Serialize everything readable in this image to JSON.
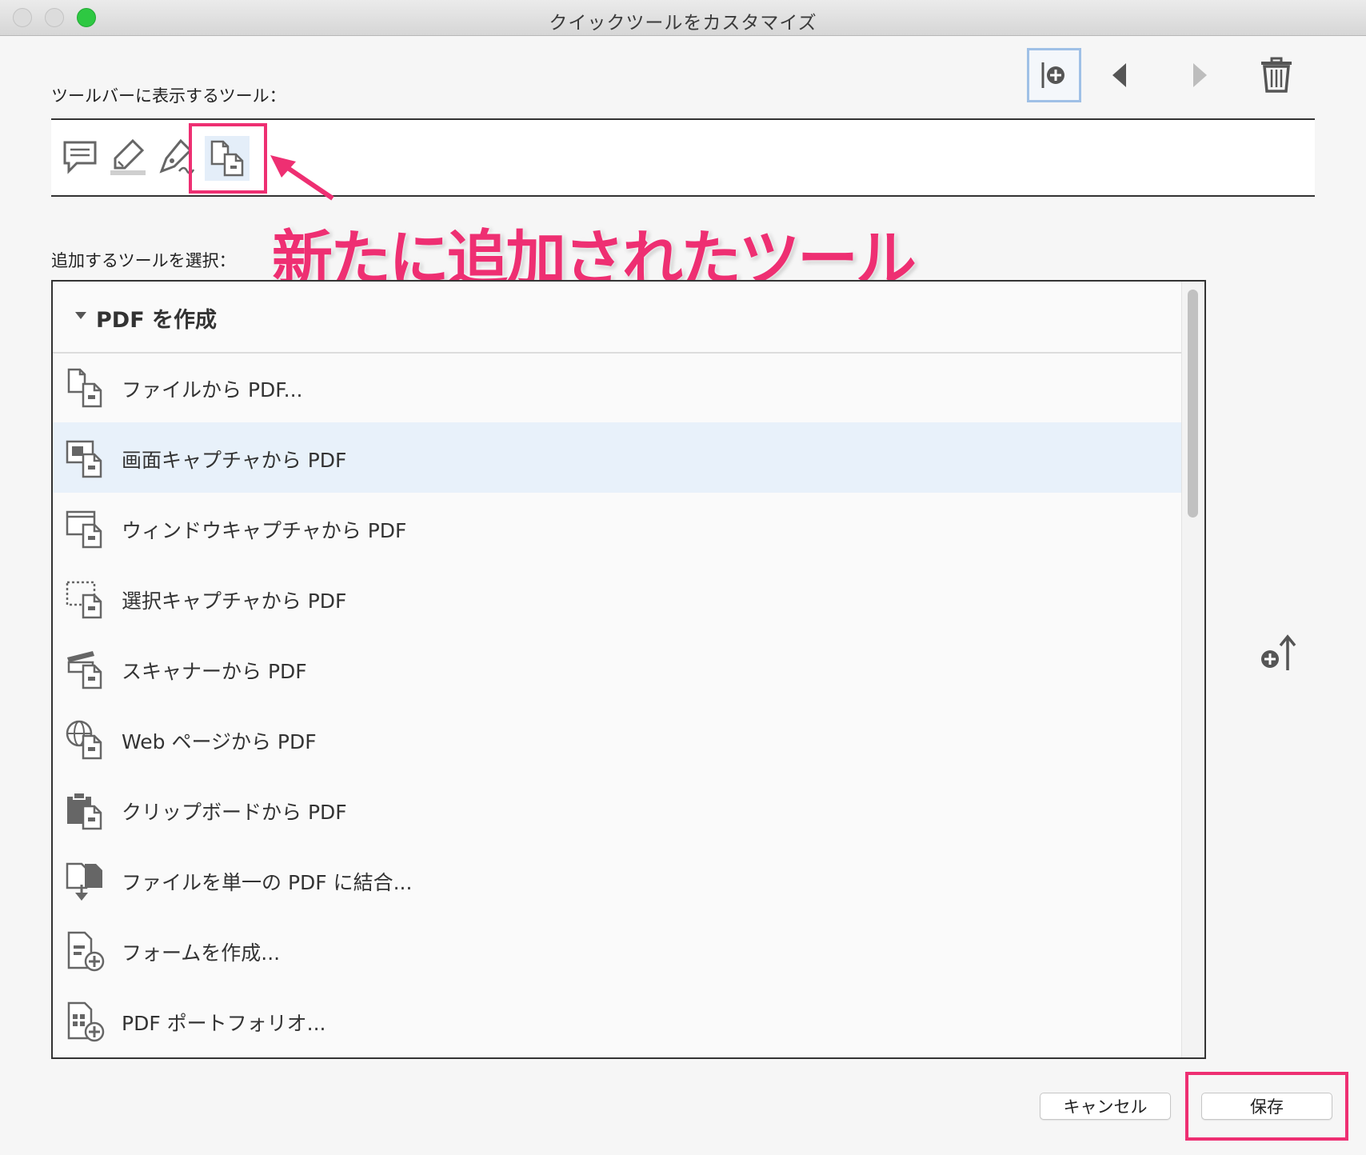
{
  "window": {
    "title": "クイックツールをカスタマイズ"
  },
  "toolbar_section": {
    "label": "ツールバーに表示するツール："
  },
  "annotation": {
    "text": "新たに追加されたツール",
    "color": "#ee2f72"
  },
  "select_section": {
    "label": "追加するツールを選択："
  },
  "group": {
    "title": "PDF を作成"
  },
  "items": [
    {
      "label": "ファイルから PDF...",
      "icon": "file-to-pdf-icon"
    },
    {
      "label": "画面キャプチャから PDF",
      "icon": "screen-capture-icon"
    },
    {
      "label": "ウィンドウキャプチャから PDF",
      "icon": "window-capture-icon"
    },
    {
      "label": "選択キャプチャから PDF",
      "icon": "selection-capture-icon"
    },
    {
      "label": "スキャナーから PDF",
      "icon": "scanner-icon"
    },
    {
      "label": "Web ページから PDF",
      "icon": "globe-icon"
    },
    {
      "label": "クリップボードから PDF",
      "icon": "clipboard-icon"
    },
    {
      "label": "ファイルを単一の PDF に結合...",
      "icon": "combine-files-icon"
    },
    {
      "label": "フォームを作成...",
      "icon": "create-form-icon"
    },
    {
      "label": "PDF ポートフォリオ...",
      "icon": "portfolio-icon"
    }
  ],
  "selected_item_index": 1,
  "buttons": {
    "cancel": "キャンセル",
    "save": "保存"
  }
}
